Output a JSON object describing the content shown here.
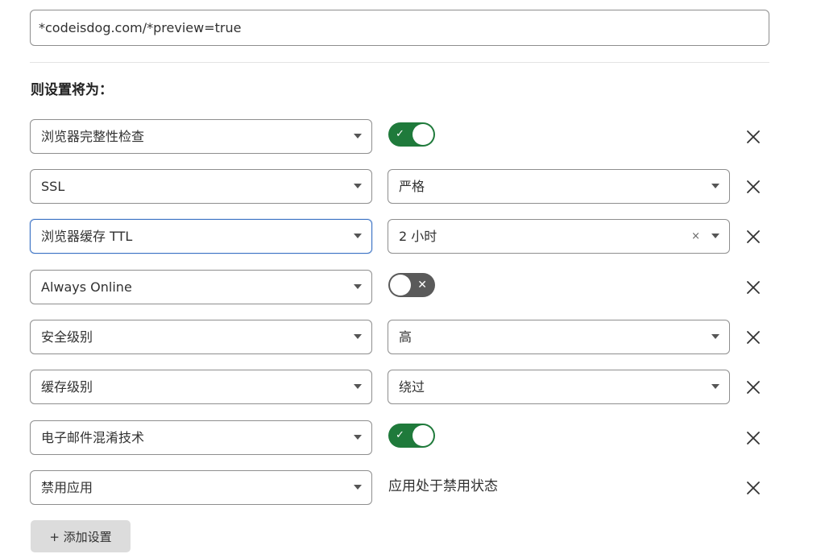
{
  "url_pattern": {
    "value": "*codeisdog.com/*preview=true"
  },
  "section_title": "则设置将为：",
  "rules": [
    {
      "setting": "浏览器完整性检查",
      "value_type": "toggle",
      "on": true
    },
    {
      "setting": "SSL",
      "value_type": "select",
      "value": "严格"
    },
    {
      "setting": "浏览器缓存 TTL",
      "value_type": "select",
      "value": "2 小时",
      "clearable": true,
      "focused": true
    },
    {
      "setting": "Always Online",
      "value_type": "toggle",
      "on": false
    },
    {
      "setting": "安全级别",
      "value_type": "select",
      "value": "高"
    },
    {
      "setting": "缓存级别",
      "value_type": "select",
      "value": "绕过"
    },
    {
      "setting": "电子邮件混淆技术",
      "value_type": "toggle",
      "on": true
    },
    {
      "setting": "禁用应用",
      "value_type": "text",
      "value": "应用处于禁用状态"
    }
  ],
  "icons": {
    "toggle_on": "check-icon",
    "toggle_off": "x-icon",
    "remove": "close-icon",
    "caret": "chevron-down-icon",
    "clear": "clear-icon"
  },
  "glyphs": {
    "check": "✓",
    "cross": "✕",
    "clear": "×"
  },
  "add_button": {
    "label": "+ 添加设置"
  },
  "colors": {
    "toggle_on": "#1f7a3b",
    "toggle_off": "#5a5a5a",
    "focus_border": "#3b72c4",
    "add_button_bg": "#dcdcdc"
  }
}
